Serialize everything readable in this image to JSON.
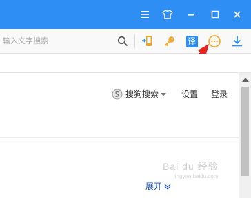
{
  "titlebar": {
    "icons": [
      "menu-icon",
      "skin-icon",
      "minimize-icon",
      "maximize-icon",
      "close-icon"
    ],
    "accent": "#2f8ef4"
  },
  "toolbar": {
    "search_placeholder": "输入文字搜索",
    "translate_glyph": "译",
    "icons": [
      "search-icon",
      "phone-transfer-icon",
      "key-icon",
      "translate-icon",
      "more-options-icon",
      "download-icon"
    ]
  },
  "page": {
    "search_engine_label": "搜狗搜索",
    "settings_label": "设置",
    "login_label": "登录",
    "expand_label": "展开"
  },
  "watermark": {
    "text": "Bai du 经验",
    "url": "jingyan.baidu.com"
  },
  "annotation": {
    "arrow_color": "#e8231b"
  }
}
